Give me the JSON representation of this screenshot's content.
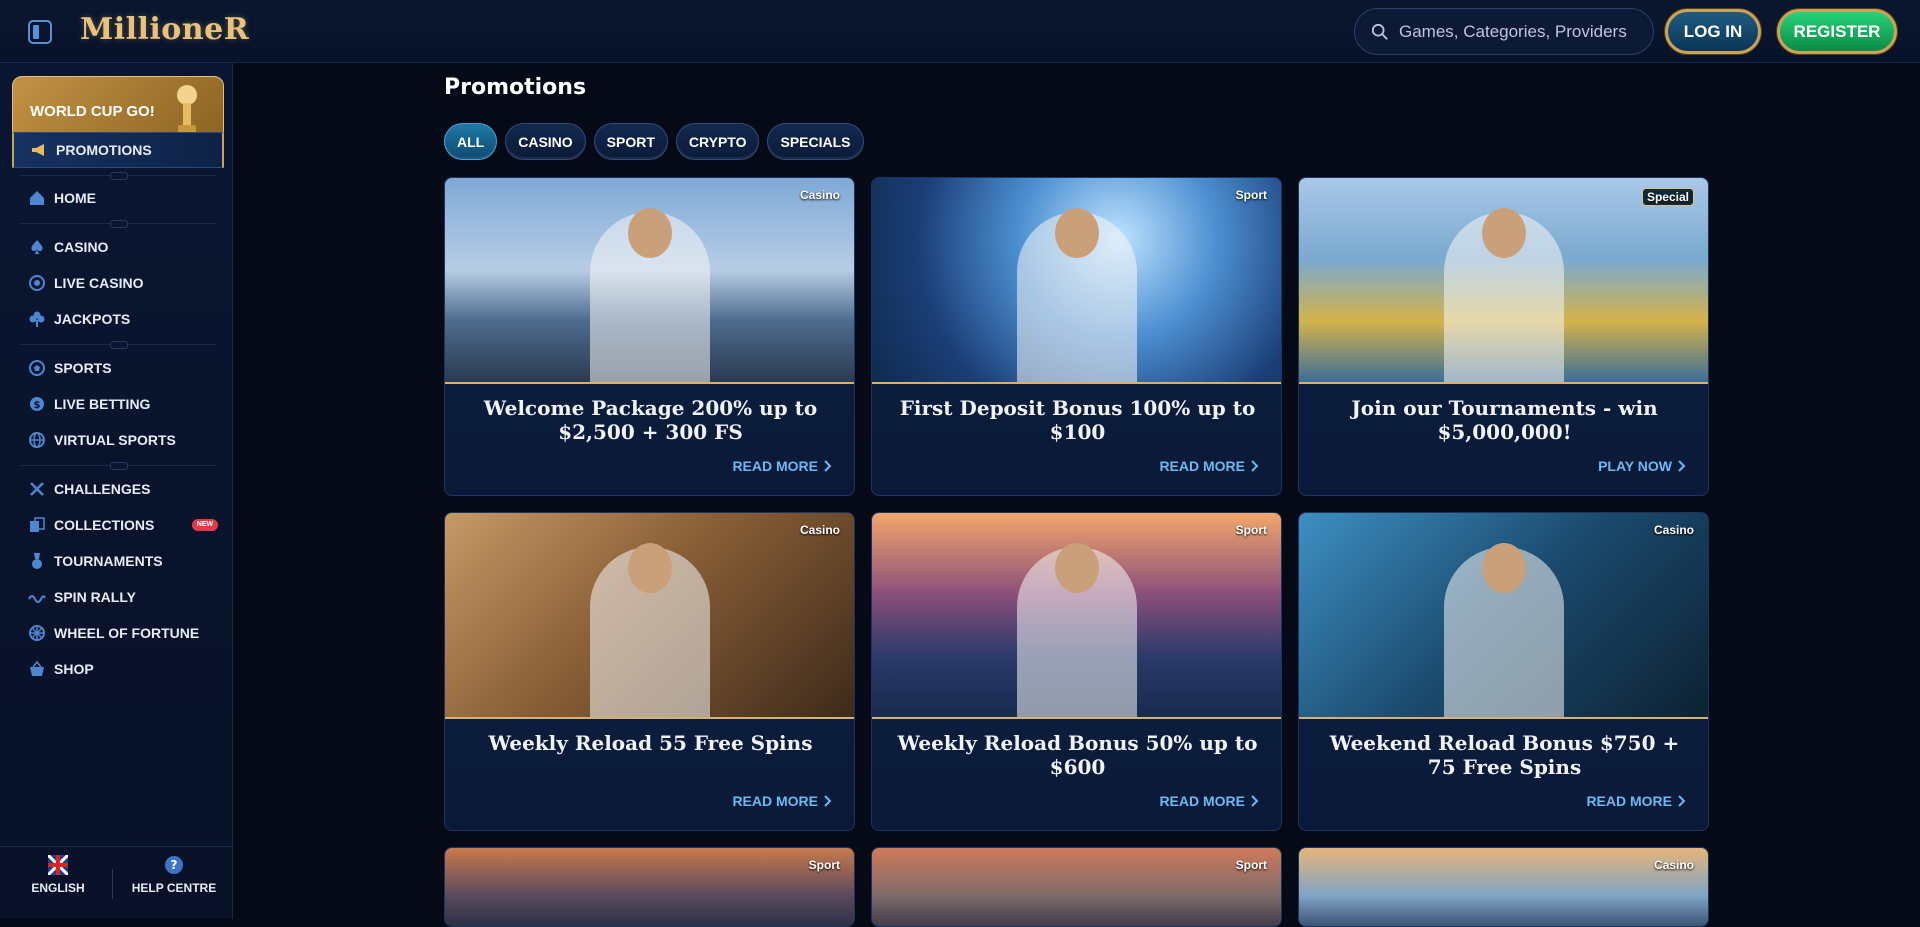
{
  "header": {
    "logo": "MillioneR",
    "search_placeholder": "Games, Categories, Providers",
    "login_label": "LOG IN",
    "register_label": "REGISTER"
  },
  "sidebar": {
    "world_cup_label": "WORLD CUP GO!",
    "items": [
      {
        "label": "PROMOTIONS",
        "icon": "megaphone-icon"
      },
      {
        "label": "HOME",
        "icon": "home-icon"
      },
      {
        "label": "CASINO",
        "icon": "spade-icon"
      },
      {
        "label": "LIVE CASINO",
        "icon": "chip-icon"
      },
      {
        "label": "JACKPOTS",
        "icon": "clover-icon"
      },
      {
        "label": "SPORTS",
        "icon": "soccer-ball-icon"
      },
      {
        "label": "LIVE BETTING",
        "icon": "live-betting-icon"
      },
      {
        "label": "VIRTUAL SPORTS",
        "icon": "globe-icon"
      },
      {
        "label": "CHALLENGES",
        "icon": "swords-icon"
      },
      {
        "label": "COLLECTIONS",
        "icon": "collections-icon",
        "badge": "NEW"
      },
      {
        "label": "TOURNAMENTS",
        "icon": "medal-icon"
      },
      {
        "label": "SPIN RALLY",
        "icon": "rally-icon"
      },
      {
        "label": "WHEEL OF FORTUNE",
        "icon": "wheel-icon"
      },
      {
        "label": "SHOP",
        "icon": "basket-icon"
      }
    ],
    "footer": {
      "language": "ENGLISH",
      "help": "HELP CENTRE"
    }
  },
  "main": {
    "title": "Promotions",
    "filters": [
      "ALL",
      "CASINO",
      "SPORT",
      "CRYPTO",
      "SPECIALS"
    ],
    "active_filter": "ALL",
    "cards": [
      {
        "tag": "Casino",
        "title": "Welcome Package 200% up to $2,500 + 300 FS",
        "cta": "READ MORE"
      },
      {
        "tag": "Sport",
        "title": "First Deposit Bonus 100% up to $100",
        "cta": "READ MORE"
      },
      {
        "tag": "Special",
        "title": "Join our Tournaments - win $5,000,000!",
        "cta": "PLAY NOW"
      },
      {
        "tag": "Casino",
        "title": "Weekly Reload 55 Free Spins",
        "cta": "READ MORE"
      },
      {
        "tag": "Sport",
        "title": "Weekly Reload Bonus 50% up to $600",
        "cta": "READ MORE"
      },
      {
        "tag": "Casino",
        "title": "Weekend Reload Bonus $750 + 75 Free Spins",
        "cta": "READ MORE"
      },
      {
        "tag": "Sport"
      },
      {
        "tag": "Sport"
      },
      {
        "tag": "Casino"
      }
    ]
  }
}
